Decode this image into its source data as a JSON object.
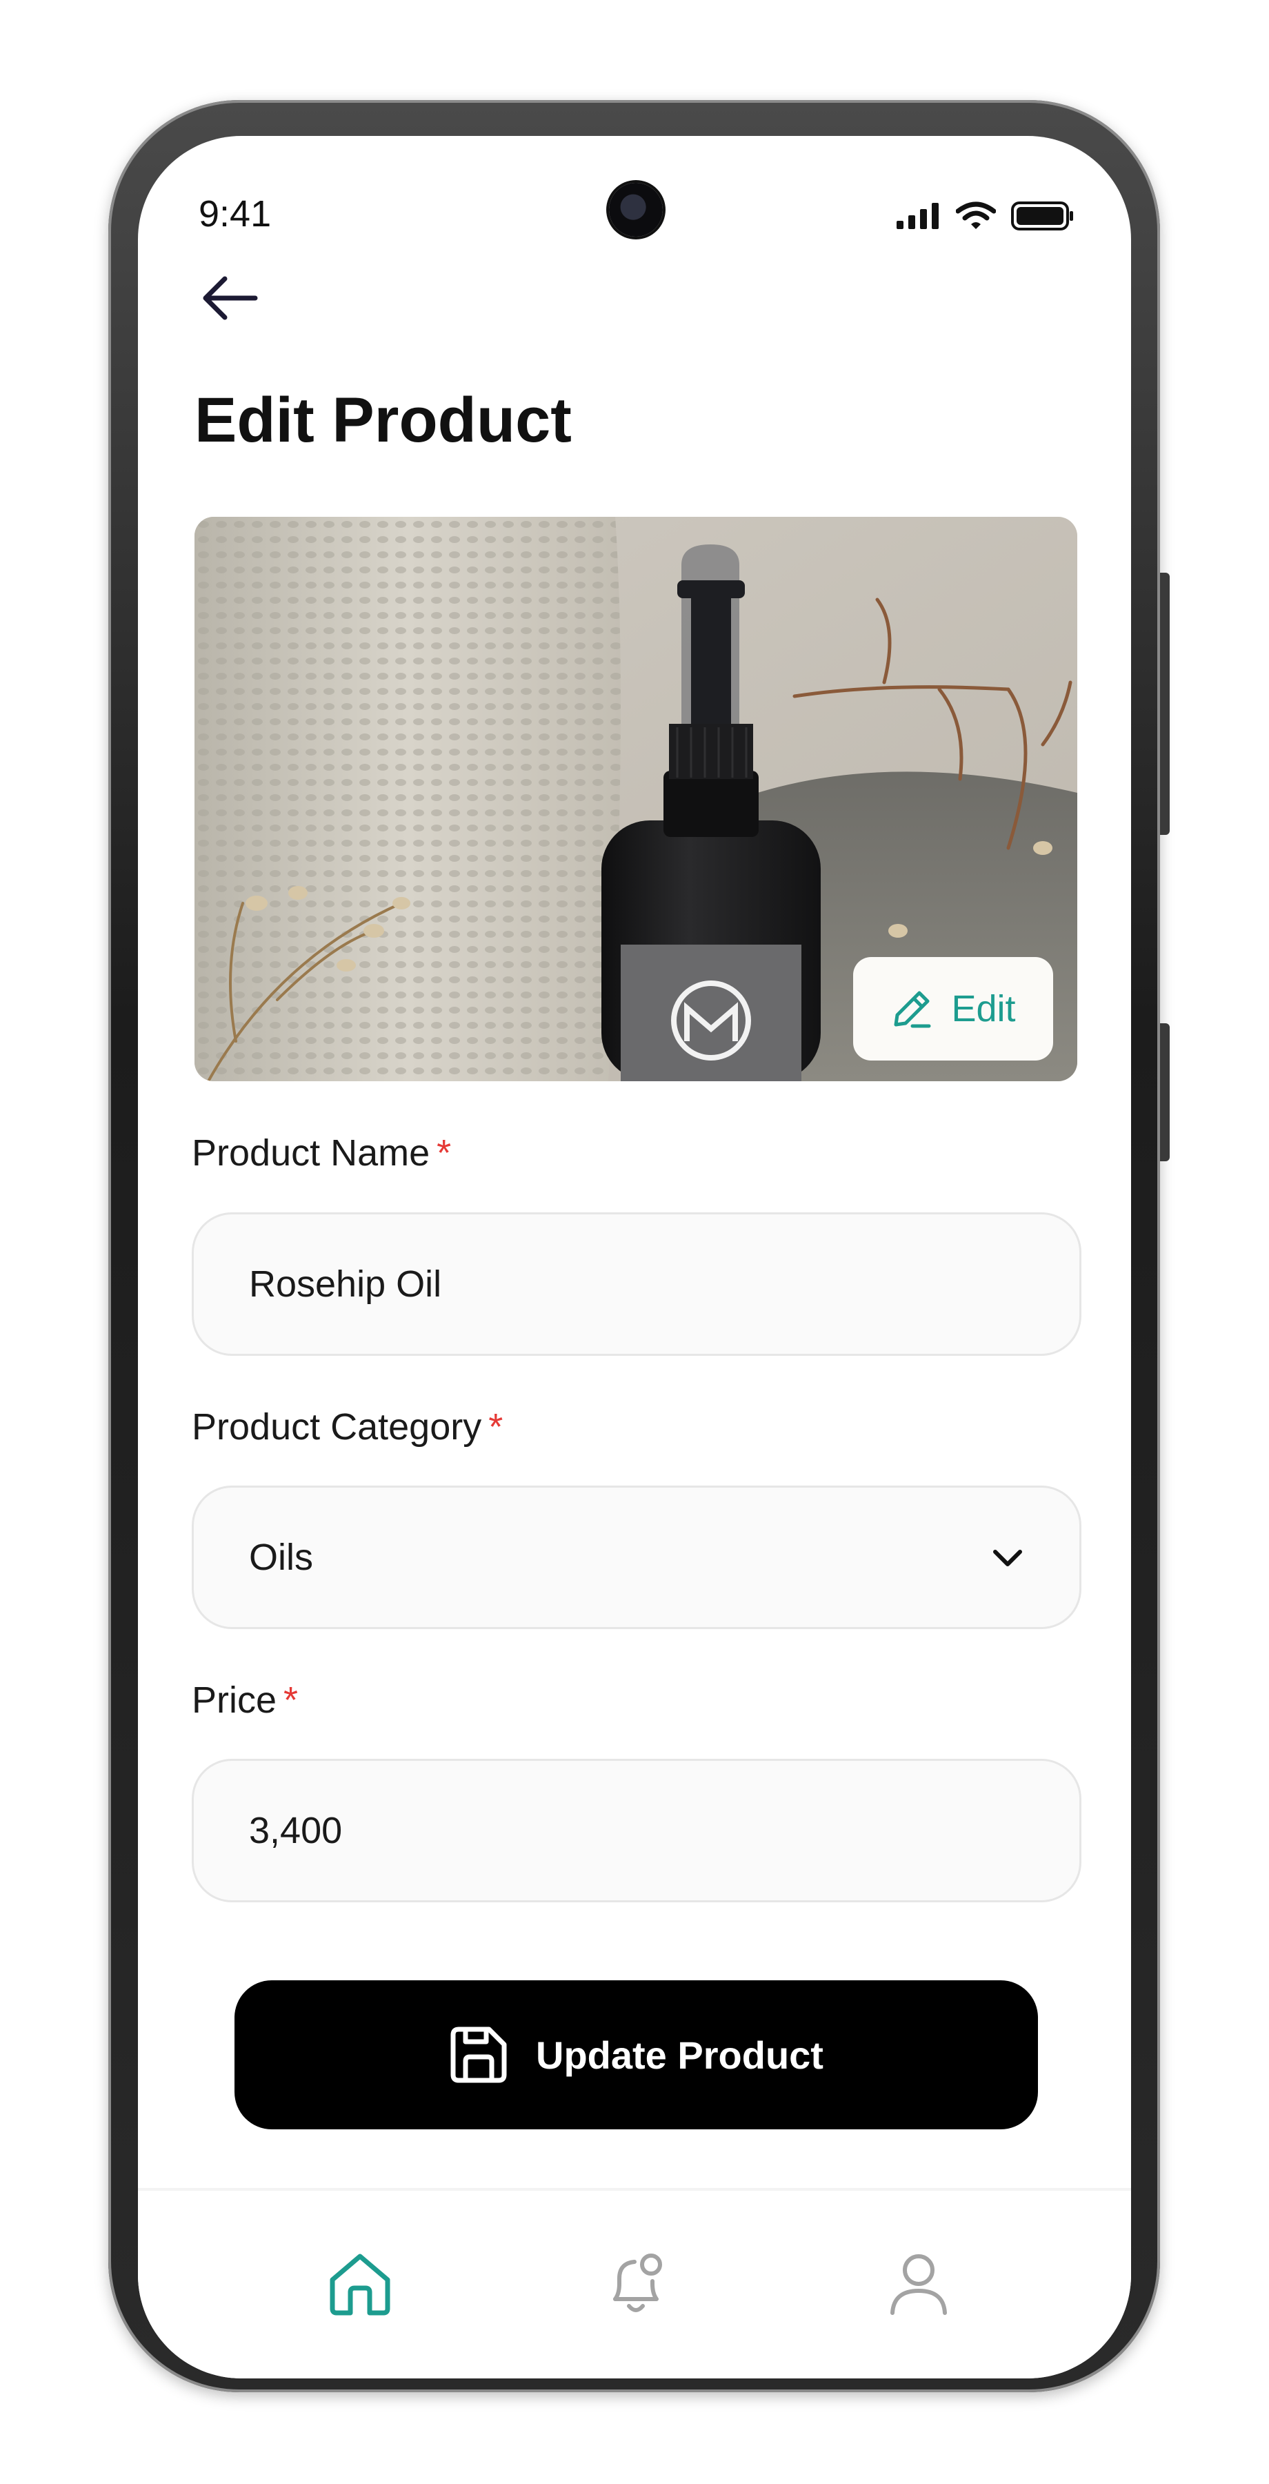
{
  "status_bar": {
    "time": "9:41"
  },
  "header": {
    "title": "Edit Product"
  },
  "product_image": {
    "edit_label": "Edit"
  },
  "form": {
    "required_marker": "*",
    "name": {
      "label": "Product Name",
      "value": "Rosehip Oil"
    },
    "category": {
      "label": "Product Category",
      "value": "Oils"
    },
    "price": {
      "label": "Price",
      "value": "3,400"
    }
  },
  "submit": {
    "label": "Update Product"
  },
  "nav": {
    "items": [
      "home-icon",
      "notification-icon",
      "profile-icon"
    ],
    "active": "home-icon"
  },
  "colors": {
    "accent": "#1d9c8f",
    "required": "#e53935",
    "button": "#000000",
    "inactive_icon": "#a3a3a3"
  }
}
